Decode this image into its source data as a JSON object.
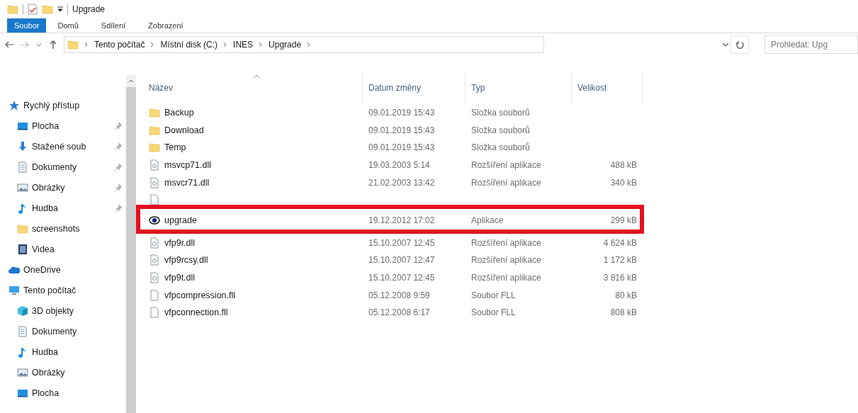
{
  "title_bar": {
    "title": "Upgrade"
  },
  "ribbon_tabs": [
    {
      "label": "Soubor",
      "selected": true
    },
    {
      "label": "Domů",
      "selected": false
    },
    {
      "label": "Sdílení",
      "selected": false
    },
    {
      "label": "Zobrazení",
      "selected": false
    }
  ],
  "address_bar": {
    "path": [
      "Tento počítač",
      "Místní disk (C:)",
      "INES",
      "Upgrade"
    ]
  },
  "search": {
    "placeholder": "Prohledat: Upg"
  },
  "sidebar": {
    "items": [
      {
        "label": "Rychlý přístup",
        "kind": "star",
        "children": [
          {
            "label": "Plocha",
            "kind": "desktop",
            "pinned": true
          },
          {
            "label": "Stažené soub",
            "kind": "download",
            "pinned": true
          },
          {
            "label": "Dokumenty",
            "kind": "docs",
            "pinned": true
          },
          {
            "label": "Obrázky",
            "kind": "pictures",
            "pinned": true
          },
          {
            "label": "Hudba",
            "kind": "music",
            "pinned": true
          },
          {
            "label": "screenshots",
            "kind": "folder",
            "pinned": false
          },
          {
            "label": "Videa",
            "kind": "video",
            "pinned": false
          }
        ]
      },
      {
        "label": "OneDrive",
        "kind": "cloud"
      },
      {
        "label": "Tento počítač",
        "kind": "pc",
        "children": [
          {
            "label": "3D objekty",
            "kind": "cube",
            "pinned": false
          },
          {
            "label": "Dokumenty",
            "kind": "docs",
            "pinned": false
          },
          {
            "label": "Hudba",
            "kind": "music",
            "pinned": false
          },
          {
            "label": "Obrázky",
            "kind": "pictures",
            "pinned": false
          },
          {
            "label": "Plocha",
            "kind": "desktop",
            "pinned": false
          }
        ]
      }
    ]
  },
  "table": {
    "columns": [
      "Název",
      "Datum změny",
      "Typ",
      "Velikost"
    ],
    "rows": [
      {
        "kind": "folder",
        "name": "Backup",
        "date": "09.01.2019 15:43",
        "type": "Složka souborů",
        "highlighted": false
      },
      {
        "kind": "folder",
        "name": "Download",
        "date": "09.01.2019 15:43",
        "type": "Složka souborů",
        "highlighted": false
      },
      {
        "kind": "folder",
        "name": "Temp",
        "date": "09.01.2019 15:43",
        "type": "Složka souborů",
        "highlighted": false
      },
      {
        "kind": "dll",
        "name": "msvcp71.dll",
        "date": "19.03.2003 5:14",
        "type": "Rozšíření aplikace",
        "size": "488 kB",
        "highlighted": false
      },
      {
        "kind": "dll",
        "name": "msvcr71.dll",
        "date": "21.02.2003 13:42",
        "type": "Rozšíření aplikace",
        "size": "340 kB",
        "highlighted": false
      },
      {
        "kind": "file",
        "highlighted": false
      },
      {
        "kind": "app",
        "name": "upgrade",
        "date": "19.12.2012 17:02",
        "type": "Aplikace",
        "size": "299 kB",
        "highlighted": true
      },
      {
        "kind": "dll",
        "name": "vfp9r.dll",
        "date": "15.10.2007 12:45",
        "type": "Rozšíření aplikace",
        "size": "4 624 kB",
        "highlighted": false
      },
      {
        "kind": "dll",
        "name": "vfp9rcsy.dll",
        "date": "15.10.2007 12:47",
        "type": "Rozšíření aplikace",
        "size": "1 172 kB",
        "highlighted": false
      },
      {
        "kind": "dll",
        "name": "vfp9t.dll",
        "date": "15.10.2007 12:45",
        "type": "Rozšíření aplikace",
        "size": "3 816 kB",
        "highlighted": false
      },
      {
        "kind": "file",
        "name": "vfpcompression.fll",
        "date": "05.12.2008 9:59",
        "type": "Soubor FLL",
        "size": "80 kB",
        "highlighted": false
      },
      {
        "kind": "file",
        "name": "vfpconnection.fll",
        "date": "05.12.2008 6:17",
        "type": "Soubor FLL",
        "size": "808 kB",
        "highlighted": false
      }
    ]
  }
}
